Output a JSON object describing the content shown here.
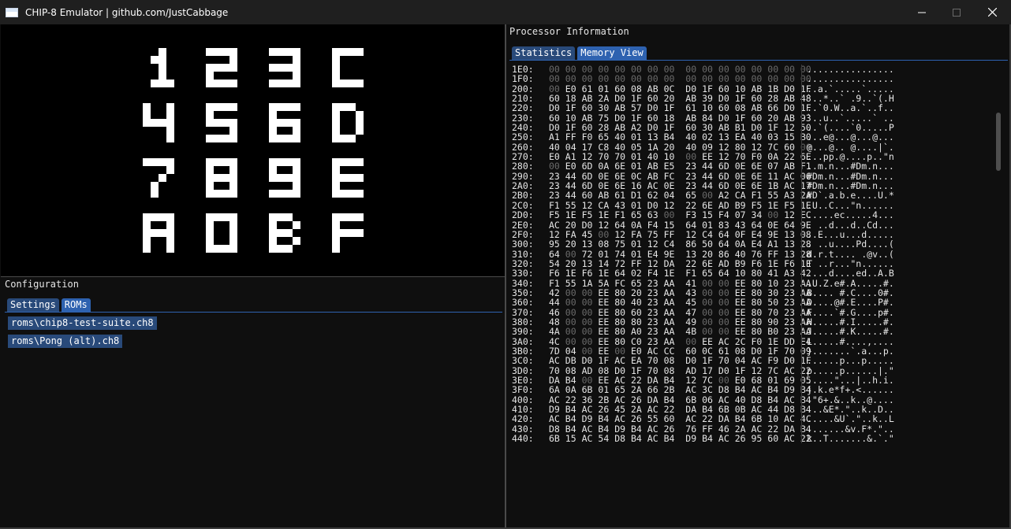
{
  "window": {
    "title": "CHIP-8 Emulator | github.com/JustCabbage",
    "icon": "app-window-icon",
    "controls": [
      "minimize-icon",
      "maximize-icon",
      "close-icon"
    ]
  },
  "display": {
    "glyphs": [
      "1",
      "2",
      "3",
      "C",
      "4",
      "5",
      "6",
      "D",
      "7",
      "8",
      "9",
      "E",
      "A",
      "0",
      "B",
      "F"
    ],
    "pixel_color": "#ffffff",
    "background": "#000000"
  },
  "configuration": {
    "title": "Configuration",
    "tabs": [
      {
        "label": "Settings",
        "active": false
      },
      {
        "label": "ROMs",
        "active": true
      }
    ],
    "roms": [
      "roms\\chip8-test-suite.ch8",
      "roms\\Pong (alt).ch8"
    ]
  },
  "processor": {
    "title": "Processor Information",
    "tabs": [
      {
        "label": "Statistics",
        "active": false
      },
      {
        "label": "Memory View",
        "active": true
      }
    ]
  },
  "memory": [
    {
      "addr": "1E0:",
      "hex": "00 00 00 00 00 00 00 00  00 00 00 00 00 00 00 00",
      "ascii": "................"
    },
    {
      "addr": "1F0:",
      "hex": "00 00 00 00 00 00 00 00  00 00 00 00 00 00 00 00",
      "ascii": "................"
    },
    {
      "addr": "200:",
      "hex": "00 E0 61 01 60 08 AB 0C  D0 1F 60 10 AB 1B D0 1F",
      "ascii": "..a.`.....`....."
    },
    {
      "addr": "210:",
      "hex": "60 18 AB 2A D0 1F 60 20  AB 39 D0 1F 60 28 AB 48",
      "ascii": "`..*..` .9..`(.H"
    },
    {
      "addr": "220:",
      "hex": "D0 1F 60 30 AB 57 D0 1F  61 10 60 08 AB 66 D0 1F",
      "ascii": "..`0.W..a.`..f.."
    },
    {
      "addr": "230:",
      "hex": "60 10 AB 75 D0 1F 60 18  AB 84 D0 1F 60 20 AB 93",
      "ascii": "`..u..`.....` .."
    },
    {
      "addr": "240:",
      "hex": "D0 1F 60 28 AB A2 D0 1F  60 30 AB B1 D0 1F 12 50",
      "ascii": "..`(....`0.....P"
    },
    {
      "addr": "250:",
      "hex": "A1 FF F0 65 40 01 13 B4  40 02 13 EA 40 03 15 B0",
      "ascii": "...e@...@...@..."
    },
    {
      "addr": "260:",
      "hex": "40 04 17 C8 40 05 1A 20  40 09 12 80 12 7C 60 00",
      "ascii": "@...@.. @....|`."
    },
    {
      "addr": "270:",
      "hex": "E0 A1 12 70 70 01 40 10  00 EE 12 70 F0 0A 22 6E",
      "ascii": "...pp.@....p..\"n"
    },
    {
      "addr": "280:",
      "hex": "00 E0 6D 0A 6E 01 AB E5  23 44 6D 0E 6E 07 AB F1",
      "ascii": "..m.n...#Dm.n..."
    },
    {
      "addr": "290:",
      "hex": "23 44 6D 0E 6E 0C AB FC  23 44 6D 0E 6E 11 AC 06",
      "ascii": "#Dm.n...#Dm.n..."
    },
    {
      "addr": "2A0:",
      "hex": "23 44 6D 0E 6E 16 AC 0E  23 44 6D 0E 6E 1B AC 17",
      "ascii": "#Dm.n...#Dm.n..."
    },
    {
      "addr": "2B0:",
      "hex": "23 44 60 AB 61 D1 62 04  65 00 A2 CA F1 55 A3 2A",
      "ascii": "#D`.a.b.e....U.*"
    },
    {
      "addr": "2C0:",
      "hex": "F1 55 12 CA 43 01 D0 12  22 6E AD B9 F5 1E F5 1E",
      "ascii": ".U..C...\"n......"
    },
    {
      "addr": "2D0:",
      "hex": "F5 1E F5 1E F1 65 63 00  F3 15 F4 07 34 00 12 EC",
      "ascii": ".....ec.....4..."
    },
    {
      "addr": "2E0:",
      "hex": "AC 20 D0 12 64 0A F4 15  64 01 83 43 64 0E 64 9E",
      "ascii": ". ..d...d..Cd..."
    },
    {
      "addr": "2F0:",
      "hex": "12 FA 45 00 12 FA 75 FF  12 C4 64 0F E4 9E 13 08",
      "ascii": "..E...u...d....."
    },
    {
      "addr": "300:",
      "hex": "95 20 13 08 75 01 12 C4  86 50 64 0A E4 A1 13 28",
      "ascii": ". ..u....Pd....("
    },
    {
      "addr": "310:",
      "hex": "64 00 72 01 74 01 E4 9E  13 20 86 40 76 FF 13 28",
      "ascii": "d.r.t.... .@v..("
    },
    {
      "addr": "320:",
      "hex": "54 20 13 14 72 FF 12 DA  22 6E AD B9 F6 1E F6 1E",
      "ascii": "T ..r...\"n......"
    },
    {
      "addr": "330:",
      "hex": "F6 1E F6 1E 64 02 F4 1E  F1 65 64 10 80 41 A3 42",
      "ascii": "....d....ed..A.B"
    },
    {
      "addr": "340:",
      "hex": "F1 55 1A 5A FC 65 23 AA  41 00 00 EE 80 10 23 AA",
      "ascii": ".U.Z.e#.A.....#."
    },
    {
      "addr": "350:",
      "hex": "42 00 00 EE 80 20 23 AA  43 00 00 EE 80 30 23 AA",
      "ascii": "B.... #.C....0#."
    },
    {
      "addr": "360:",
      "hex": "44 00 00 EE 80 40 23 AA  45 00 00 EE 80 50 23 AA",
      "ascii": "D....@#.E....P#."
    },
    {
      "addr": "370:",
      "hex": "46 00 00 EE 80 60 23 AA  47 00 00 EE 80 70 23 AA",
      "ascii": "F....`#.G....p#."
    },
    {
      "addr": "380:",
      "hex": "48 00 00 EE 80 80 23 AA  49 00 00 EE 80 90 23 AA",
      "ascii": "H.....#.I.....#."
    },
    {
      "addr": "390:",
      "hex": "4A 00 00 EE 80 A0 23 AA  4B 00 00 EE 80 B0 23 AA",
      "ascii": "J.....#.K.....#."
    },
    {
      "addr": "3A0:",
      "hex": "4C 00 00 EE 80 C0 23 AA  00 EE AC 2C F0 1E DD E4",
      "ascii": "L.....#....,...."
    },
    {
      "addr": "3B0:",
      "hex": "7D 04 00 EE 00 E0 AC CC  60 0C 61 08 D0 1F 70 09",
      "ascii": "}.......`.a...p."
    },
    {
      "addr": "3C0:",
      "hex": "AC DB D0 1F AC EA 70 08  D0 1F 70 04 AC F9 D0 1F",
      "ascii": "......p...p....."
    },
    {
      "addr": "3D0:",
      "hex": "70 08 AD 08 D0 1F 70 08  AD 17 D0 1F 12 7C AC 22",
      "ascii": "p.....p......|.\""
    },
    {
      "addr": "3E0:",
      "hex": "DA B4 00 EE AC 22 DA B4  12 7C 00 E0 68 01 69 05",
      "ascii": ".....\"...|..h.i."
    },
    {
      "addr": "3F0:",
      "hex": "6A 0A 6B 01 65 2A 66 2B  AC 3C D8 B4 AC B4 D9 B4",
      "ascii": "j.k.e*f+.<......"
    },
    {
      "addr": "400:",
      "hex": "AC 22 36 2B AC 26 DA B4  6B 06 AC 40 D8 B4 AC B4",
      "ascii": ".\"6+.&..k..@...."
    },
    {
      "addr": "410:",
      "hex": "D9 B4 AC 26 45 2A AC 22  DA B4 6B 0B AC 44 D8 B4",
      "ascii": "...&E*.\"..k..D.."
    },
    {
      "addr": "420:",
      "hex": "AC B4 D9 B4 AC 26 55 60  AC 22 DA B4 6B 10 AC 4C",
      "ascii": ".....&U`.\"..k..L"
    },
    {
      "addr": "430:",
      "hex": "D8 B4 AC B4 D9 B4 AC 26  76 FF 46 2A AC 22 DA B4",
      "ascii": ".......&v.F*.\".."
    },
    {
      "addr": "440:",
      "hex": "6B 15 AC 54 D8 B4 AC B4  D9 B4 AC 26 95 60 AC 22",
      "ascii": "k..T.......&.`.\""
    }
  ]
}
